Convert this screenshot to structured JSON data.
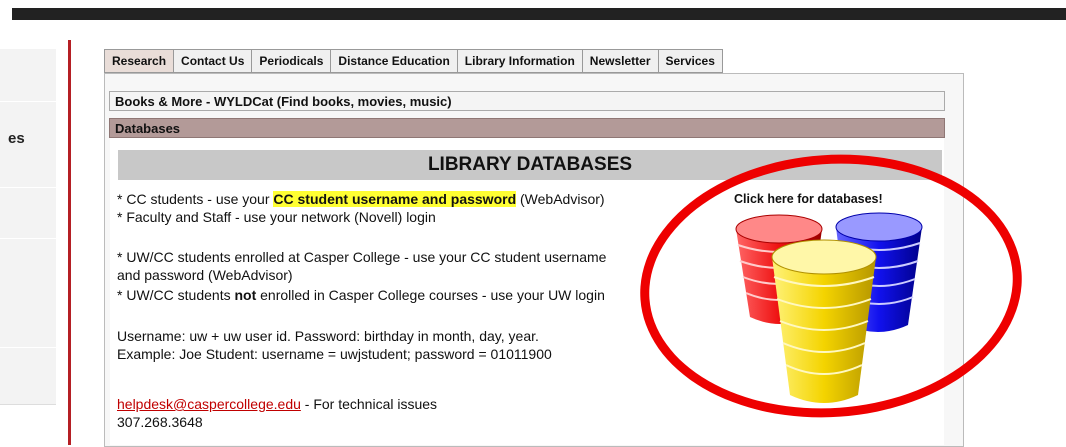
{
  "leftnav": {
    "items": [
      {
        "label": ""
      },
      {
        "label": "es"
      },
      {
        "label": ""
      },
      {
        "label": ""
      },
      {
        "label": ""
      }
    ]
  },
  "tabs": [
    {
      "label": "Research",
      "active": true
    },
    {
      "label": "Contact Us"
    },
    {
      "label": "Periodicals"
    },
    {
      "label": "Distance Education"
    },
    {
      "label": "Library Information"
    },
    {
      "label": "Newsletter"
    },
    {
      "label": "Services"
    }
  ],
  "accordion": {
    "books": "Books & More - WYLDCat (Find books, movies, music)",
    "databases": "Databases"
  },
  "db": {
    "header": "LIBRARY DATABASES",
    "line1_pre": "* CC students - use your ",
    "line1_hl": "CC student username and password",
    "line1_post": " (WebAdvisor)",
    "line2": "* Faculty and Staff - use your network (Novell) login",
    "line3": "* UW/CC students enrolled at Casper College - use your CC student username",
    "line4": "and password (WebAdvisor)",
    "line5_pre": "* UW/CC students ",
    "line5_bold": "not",
    "line5_post": " enrolled in Casper College courses - use your UW login",
    "line6": "Username: uw + uw user id. Password: birthday in month, day, year.",
    "line7": "Example: Joe Student: username = uwjstudent; password = 01011900",
    "email": "helpdesk@caspercollege.edu",
    "email_post": " - For technical issues",
    "phone": "307.268.3648",
    "image_title": "Click here for databases!"
  },
  "colors": {
    "accent_red": "#b51f24",
    "highlight": "#ffff33",
    "annotation_circle": "#ee0000"
  }
}
